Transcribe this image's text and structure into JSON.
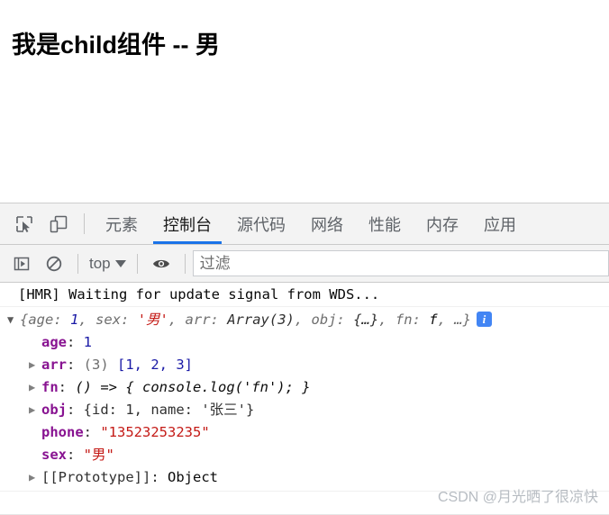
{
  "page": {
    "heading": "我是child组件 -- 男"
  },
  "devtools": {
    "icons": {
      "inspect": "inspect-element-icon",
      "device": "device-toolbar-icon",
      "sidebar": "console-sidebar-icon",
      "clear": "clear-console-icon",
      "eye": "live-expression-eye-icon"
    },
    "tabs": [
      {
        "label": "元素",
        "active": false
      },
      {
        "label": "控制台",
        "active": true
      },
      {
        "label": "源代码",
        "active": false
      },
      {
        "label": "网络",
        "active": false
      },
      {
        "label": "性能",
        "active": false
      },
      {
        "label": "内存",
        "active": false
      },
      {
        "label": "应用",
        "active": false
      }
    ],
    "console_toolbar": {
      "context": "top",
      "filter_placeholder": "过滤",
      "filter_value": ""
    },
    "console": {
      "messages": [
        {
          "text": "[HMR] Waiting for update signal from WDS..."
        }
      ],
      "object": {
        "summary": {
          "open_brace": "{",
          "parts": [
            {
              "name": "age",
              "sep": ": ",
              "value": "1",
              "kind": "num",
              "comma": ", "
            },
            {
              "name": "sex",
              "sep": ": ",
              "value": "'男'",
              "kind": "str",
              "comma": ", "
            },
            {
              "name": "arr",
              "sep": ": ",
              "value": "Array(3)",
              "kind": "plain",
              "comma": ", "
            },
            {
              "name": "obj",
              "sep": ": ",
              "value": "{…}",
              "kind": "plain",
              "comma": ", "
            },
            {
              "name": "fn",
              "sep": ": ",
              "value": "f",
              "kind": "plain",
              "comma": ", "
            }
          ],
          "ellipsis": "…",
          "close_brace": "}",
          "badge": "i"
        },
        "properties": [
          {
            "expandable": false,
            "name": "age",
            "sep": ": ",
            "value": "1",
            "kind": "num"
          },
          {
            "expandable": true,
            "name": "arr",
            "sep": ": ",
            "prefix": "(3) ",
            "value": "[1, 2, 3]",
            "kind": "array"
          },
          {
            "expandable": true,
            "name": "fn",
            "sep": ": ",
            "value": "() => { console.log('fn'); }",
            "kind": "function"
          },
          {
            "expandable": true,
            "name": "obj",
            "sep": ": ",
            "value": "{id: 1, name: '张三'}",
            "kind": "object"
          },
          {
            "expandable": false,
            "name": "phone",
            "sep": ": ",
            "value": "\"13523253235\"",
            "kind": "str"
          },
          {
            "expandable": false,
            "name": "sex",
            "sep": ": ",
            "value": "\"男\"",
            "kind": "str"
          },
          {
            "expandable": true,
            "name": "[[Prototype]]",
            "sep": ": ",
            "value": "Object",
            "kind": "proto"
          }
        ]
      }
    }
  },
  "watermark": "CSDN @月光晒了很凉快",
  "colors": {
    "accent": "#1a73e8",
    "property": "#881391",
    "number": "#1a1aa6",
    "string": "#c41a16",
    "toolbar_bg": "#f3f3f3",
    "info_badge": "#4285f4"
  }
}
